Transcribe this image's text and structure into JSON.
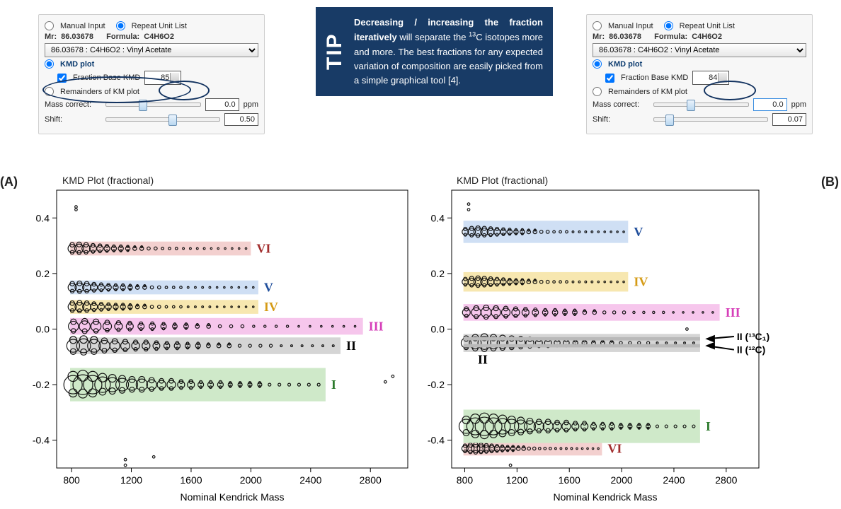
{
  "panel": {
    "manual_input": "Manual Input",
    "repeat_unit_list": "Repeat Unit List",
    "mr_label": "Mr:",
    "mr_val": "86.03678",
    "formula_label": "Formula:",
    "formula_val": "C4H6O2",
    "dropdown": "86.03678 : C4H6O2 : Vinyl Acetate",
    "kmd_plot": "KMD plot",
    "fraction_base": "Fraction Base KMD",
    "remainders": "Remainders of KM plot",
    "mass_correct": "Mass correct:",
    "ppm": "ppm",
    "shift": "Shift:",
    "A": {
      "spin": "85",
      "mass": "0.0",
      "shift": "0.50"
    },
    "B": {
      "spin": "84",
      "mass": "0.0",
      "shift": "0.07"
    }
  },
  "tip": {
    "label": "TIP",
    "html_parts": {
      "b1": "Decreasing / increasing the fraction iteratively",
      "rest": " will separate the ",
      "sup": "13",
      "rest2": "C isotopes more and more. The best fractions for any expected variation of composition are easily picked from a simple graphical tool [4]."
    }
  },
  "plot": {
    "title": "KMD Plot (fractional)",
    "xlabel": "Nominal Kendrick Mass",
    "A_label": "(A)",
    "B_label": "(B)",
    "xticks": [
      800,
      1200,
      1600,
      2000,
      2400,
      2800
    ],
    "yticks": [
      -0.4,
      -0.2,
      0.0,
      0.2,
      0.4
    ],
    "xrange": [
      700,
      3050
    ],
    "yrange": [
      -0.5,
      0.5
    ]
  },
  "iso": {
    "a": "II (¹³C₁)",
    "b": "II (¹²C)",
    "II": "II"
  },
  "chart_data": [
    {
      "id": "A",
      "type": "scatter-band",
      "bands": [
        {
          "name": "I",
          "color": "#cfe9c9",
          "y": -0.2,
          "h": 0.12,
          "x0": 790,
          "x1": 2500,
          "label_color": "#2c7a2c"
        },
        {
          "name": "II",
          "color": "#d5d5d5",
          "y": -0.06,
          "h": 0.06,
          "x0": 790,
          "x1": 2600,
          "label_color": "#000000"
        },
        {
          "name": "III",
          "color": "#f6c6ec",
          "y": 0.01,
          "h": 0.06,
          "x0": 790,
          "x1": 2750,
          "label_color": "#d63fb9"
        },
        {
          "name": "IV",
          "color": "#f7e7b0",
          "y": 0.08,
          "h": 0.05,
          "x0": 790,
          "x1": 2050,
          "label_color": "#d59b16"
        },
        {
          "name": "V",
          "color": "#cfdff4",
          "y": 0.15,
          "h": 0.05,
          "x0": 790,
          "x1": 2050,
          "label_color": "#214f9c"
        },
        {
          "name": "VI",
          "color": "#f3d0cf",
          "y": 0.29,
          "h": 0.05,
          "x0": 790,
          "x1": 2000,
          "label_color": "#a12d2d"
        }
      ],
      "outliers": [
        {
          "x": 830,
          "y": 0.43
        },
        {
          "x": 830,
          "y": 0.44
        },
        {
          "x": 1160,
          "y": -0.47
        },
        {
          "x": 1160,
          "y": -0.49
        },
        {
          "x": 1350,
          "y": -0.46
        },
        {
          "x": 2900,
          "y": -0.19
        },
        {
          "x": 2950,
          "y": -0.17
        }
      ],
      "size_profile": [
        13,
        14,
        13,
        11,
        10,
        9,
        8,
        8,
        7,
        6,
        6,
        5,
        5,
        4,
        4,
        4,
        3,
        3,
        3,
        3,
        2,
        2,
        2,
        2,
        2,
        2
      ]
    },
    {
      "id": "B",
      "type": "scatter-band",
      "bands": [
        {
          "name": "VI",
          "color": "#f3d0cf",
          "y": -0.43,
          "h": 0.05,
          "x0": 790,
          "x1": 1850,
          "label_color": "#a12d2d"
        },
        {
          "name": "I",
          "color": "#cfe9c9",
          "y": -0.35,
          "h": 0.12,
          "x0": 790,
          "x1": 2600,
          "label_color": "#2c7a2c"
        },
        {
          "name": "II",
          "color": "#d5d5d5",
          "y": -0.05,
          "h": 0.065,
          "x0": 790,
          "x1": 2600,
          "label_color": "#000000"
        },
        {
          "name": "III",
          "color": "#f6c6ec",
          "y": 0.06,
          "h": 0.06,
          "x0": 790,
          "x1": 2750,
          "label_color": "#d63fb9"
        },
        {
          "name": "IV",
          "color": "#f7e7b0",
          "y": 0.17,
          "h": 0.07,
          "x0": 790,
          "x1": 2050,
          "label_color": "#d59b16"
        },
        {
          "name": "V",
          "color": "#cfdff4",
          "y": 0.35,
          "h": 0.08,
          "x0": 790,
          "x1": 2050,
          "label_color": "#214f9c"
        }
      ],
      "sub_bands_II": [
        {
          "y": -0.035,
          "h": 0.012
        },
        {
          "y": -0.06,
          "h": 0.012
        }
      ],
      "outliers": [
        {
          "x": 830,
          "y": 0.43
        },
        {
          "x": 830,
          "y": 0.45
        },
        {
          "x": 1150,
          "y": -0.49
        },
        {
          "x": 2500,
          "y": 0.0
        }
      ],
      "size_profile": [
        10,
        12,
        13,
        12,
        11,
        10,
        9,
        8,
        7,
        7,
        6,
        6,
        5,
        5,
        4,
        4,
        4,
        3,
        3,
        3,
        3,
        2,
        2,
        2,
        2,
        2
      ]
    }
  ]
}
